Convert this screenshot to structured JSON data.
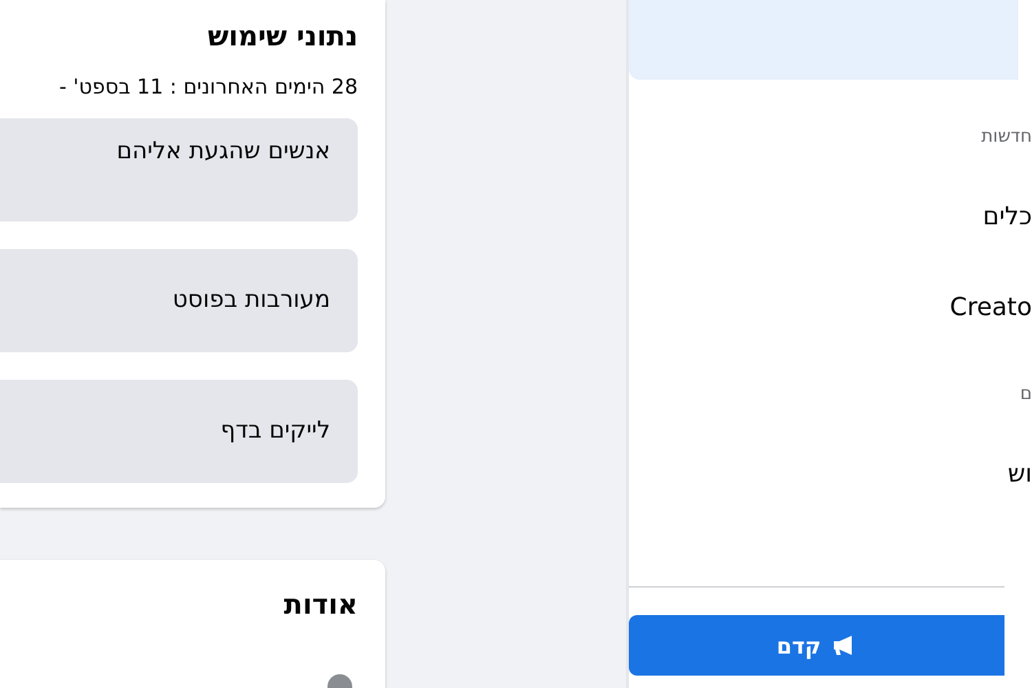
{
  "usage_card": {
    "title": "נתוני שימוש",
    "period": "28 הימים האחרונים : 11 בספט' -",
    "stats": [
      {
        "label": "אנשים שהגעת אליהם"
      },
      {
        "label": "מעורבות בפוסט"
      },
      {
        "label": "לייקים בדף"
      }
    ]
  },
  "about_card": {
    "title": "אודות"
  },
  "side_panel": {
    "items": [
      {
        "kind": "subtitle",
        "text": "חדשות"
      },
      {
        "kind": "item",
        "text": "כלים"
      },
      {
        "kind": "item",
        "text": "Creato"
      },
      {
        "kind": "subtitle",
        "text": "ם"
      },
      {
        "kind": "item",
        "text": "וש"
      }
    ],
    "promote_button": "קדם"
  }
}
